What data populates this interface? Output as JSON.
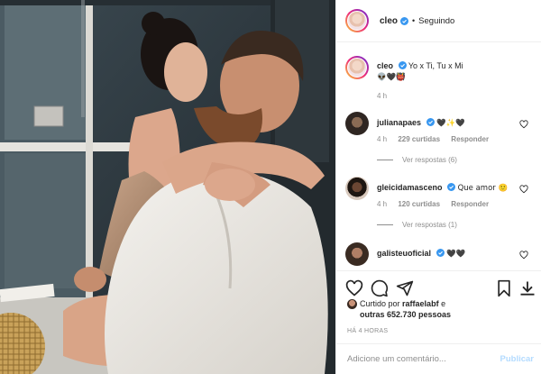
{
  "post": {
    "author": "cleo",
    "verified": true,
    "separator": "•",
    "follow_state": "Seguindo"
  },
  "caption": {
    "user": "cleo",
    "text": "Yo x Ti, Tu x Mi",
    "emojis": "👽🖤👹",
    "time": "4 h"
  },
  "comments": [
    {
      "user": "julianapaes",
      "text": "🖤✨🖤",
      "time": "4 h",
      "likes": "229 curtidas",
      "reply_label": "Responder",
      "view_replies": "Ver respostas (6)"
    },
    {
      "user": "gleicidamasceno",
      "text": "Que amor 🙂",
      "time": "4 h",
      "likes": "120 curtidas",
      "reply_label": "Responder",
      "view_replies": "Ver respostas (1)"
    },
    {
      "user": "galisteuoficial",
      "text": "🖤🖤",
      "time": "",
      "likes": "",
      "reply_label": "",
      "view_replies": ""
    }
  ],
  "likes": {
    "prefix": "Curtido por",
    "user": "raffaelabf",
    "joiner": "e",
    "others": "outras 652.730 pessoas"
  },
  "timestamp": "HÁ 4 HORAS",
  "add_comment": {
    "placeholder": "Adicione um comentário...",
    "post_label": "Publicar"
  },
  "icons": {
    "like": "heart-icon",
    "comment": "comment-icon",
    "share": "share-icon",
    "save": "bookmark-icon",
    "download": "download-icon",
    "verified": "verified-badge-icon"
  },
  "colors": {
    "verified": "#3897f0",
    "muted": "#8e8e8e",
    "post_disabled": "#b3dbff"
  }
}
